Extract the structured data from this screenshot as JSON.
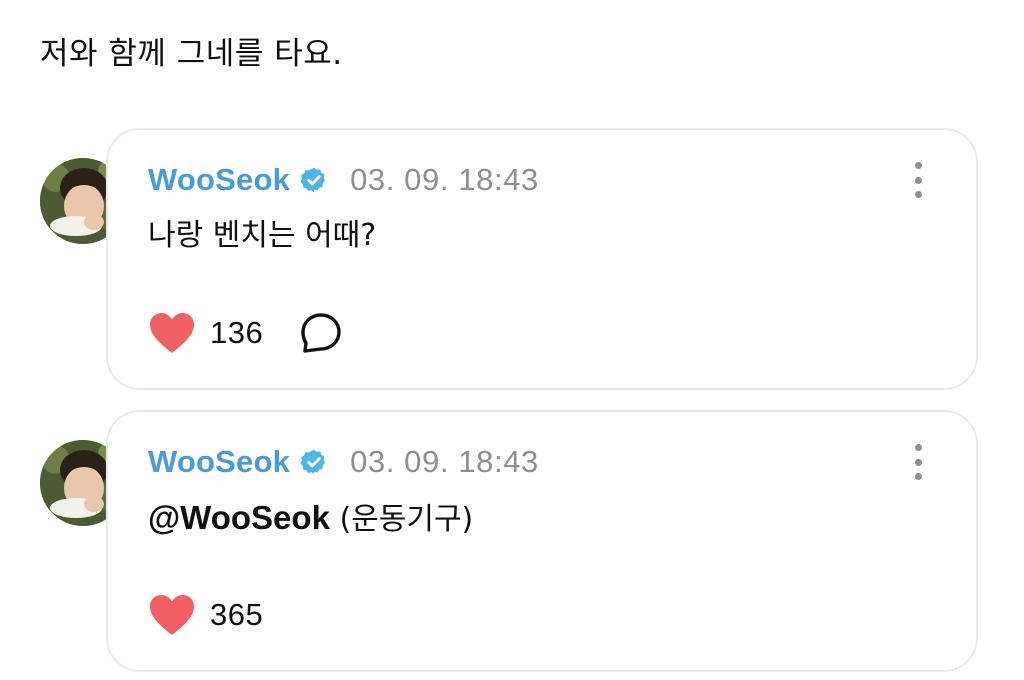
{
  "post": {
    "text": "저와 함께 그네를 타요."
  },
  "comments": [
    {
      "author": "WooSeok",
      "verified": true,
      "timestamp": "03. 09. 18:43",
      "body": "나랑 벤치는 어때?",
      "likes": "136",
      "has_reply_button": true
    },
    {
      "author": "WooSeok",
      "verified": true,
      "timestamp": "03. 09. 18:43",
      "mention": "@WooSeok",
      "body": " (운동기구)",
      "likes": "365",
      "has_reply_button": false
    }
  ],
  "icons": {
    "verified": "verified-badge-icon",
    "more": "more-vertical-icon",
    "like": "heart-icon",
    "reply": "speech-bubble-icon"
  },
  "colors": {
    "author_name": "#4a9bd9",
    "verified_badge": "#4fb6e3",
    "timestamp": "#8e8e93",
    "heart": "#ef5f63",
    "card_border": "#e9e9ee"
  }
}
